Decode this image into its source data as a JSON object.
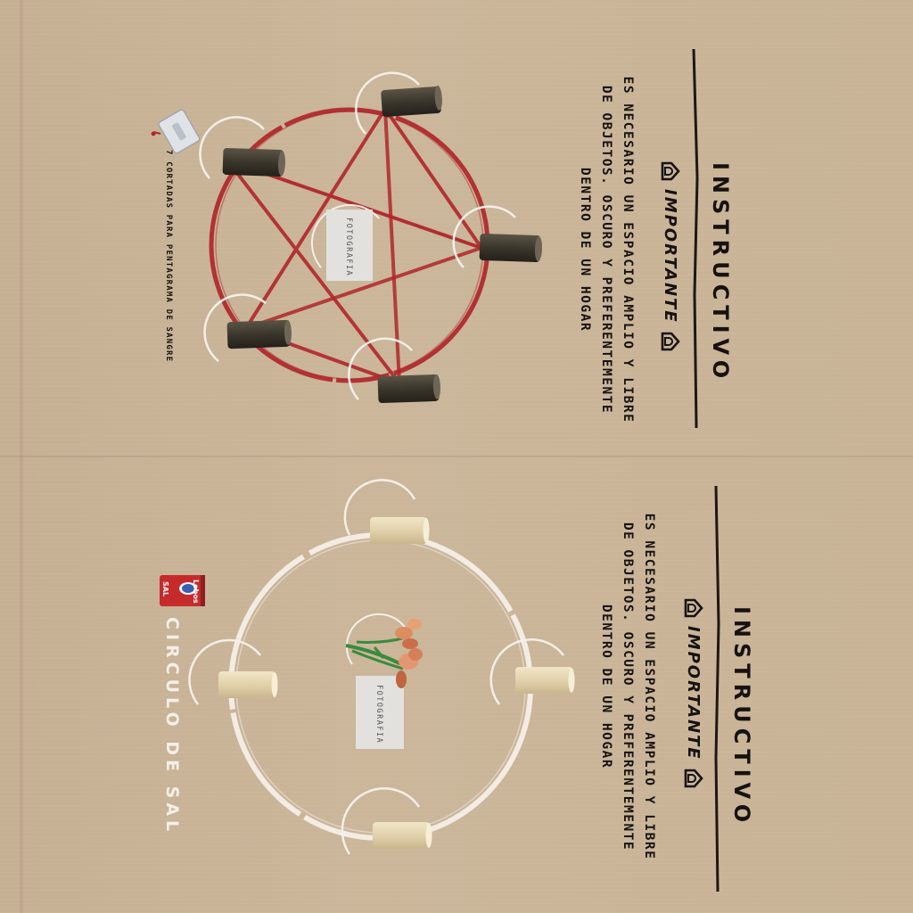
{
  "top_panel": {
    "title": "INSTRUCTIVO",
    "important": "IMPORTANTE",
    "body": "ES NECESARIO UN ESPACIO AMPLIO Y LIBRE DE OBJETOS. OSCURO Y PREFERENTEMENTE DENTRO DE UN HOGAR",
    "photo_label": "FOTOGRAFIA",
    "caption": "7 CORTADAS PARA PENTAGRAMA DE SANGRE",
    "icons": [
      "razor-blade-icon",
      "house-icon",
      "candle-icon",
      "pentagram-icon"
    ]
  },
  "bottom_panel": {
    "title": "INSTRUCTIVO",
    "important": "IMPORTANTE",
    "body": "ES NECESARIO UN ESPACIO AMPLIO Y LIBRE DE OBJETOS. OSCURO Y PREFERENTEMENTE DENTRO DE UN HOGAR",
    "photo_label": "FOTOGRAFIA",
    "caption": "CIRCULO DE SAL",
    "salt_brand": "Lobos",
    "salt_label": "SAL",
    "icons": [
      "salt-can-icon",
      "house-icon",
      "candle-icon",
      "flower-icon"
    ]
  },
  "colors": {
    "paper": "#c9b497",
    "ink": "#161210",
    "blood": "#b0262a",
    "salt": "#f4efe8",
    "dark_candle": "#3f3a30",
    "light_candle": "#e6d7b4"
  }
}
